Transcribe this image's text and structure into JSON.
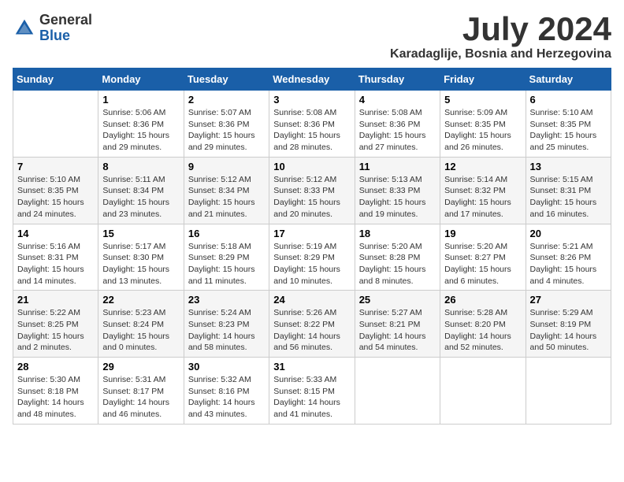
{
  "logo": {
    "general": "General",
    "blue": "Blue"
  },
  "title": "July 2024",
  "location": "Karadaglije, Bosnia and Herzegovina",
  "weekdays": [
    "Sunday",
    "Monday",
    "Tuesday",
    "Wednesday",
    "Thursday",
    "Friday",
    "Saturday"
  ],
  "weeks": [
    [
      {
        "day": "",
        "sunrise": "",
        "sunset": "",
        "daylight": ""
      },
      {
        "day": "1",
        "sunrise": "Sunrise: 5:06 AM",
        "sunset": "Sunset: 8:36 PM",
        "daylight": "Daylight: 15 hours and 29 minutes."
      },
      {
        "day": "2",
        "sunrise": "Sunrise: 5:07 AM",
        "sunset": "Sunset: 8:36 PM",
        "daylight": "Daylight: 15 hours and 29 minutes."
      },
      {
        "day": "3",
        "sunrise": "Sunrise: 5:08 AM",
        "sunset": "Sunset: 8:36 PM",
        "daylight": "Daylight: 15 hours and 28 minutes."
      },
      {
        "day": "4",
        "sunrise": "Sunrise: 5:08 AM",
        "sunset": "Sunset: 8:36 PM",
        "daylight": "Daylight: 15 hours and 27 minutes."
      },
      {
        "day": "5",
        "sunrise": "Sunrise: 5:09 AM",
        "sunset": "Sunset: 8:35 PM",
        "daylight": "Daylight: 15 hours and 26 minutes."
      },
      {
        "day": "6",
        "sunrise": "Sunrise: 5:10 AM",
        "sunset": "Sunset: 8:35 PM",
        "daylight": "Daylight: 15 hours and 25 minutes."
      }
    ],
    [
      {
        "day": "7",
        "sunrise": "Sunrise: 5:10 AM",
        "sunset": "Sunset: 8:35 PM",
        "daylight": "Daylight: 15 hours and 24 minutes."
      },
      {
        "day": "8",
        "sunrise": "Sunrise: 5:11 AM",
        "sunset": "Sunset: 8:34 PM",
        "daylight": "Daylight: 15 hours and 23 minutes."
      },
      {
        "day": "9",
        "sunrise": "Sunrise: 5:12 AM",
        "sunset": "Sunset: 8:34 PM",
        "daylight": "Daylight: 15 hours and 21 minutes."
      },
      {
        "day": "10",
        "sunrise": "Sunrise: 5:12 AM",
        "sunset": "Sunset: 8:33 PM",
        "daylight": "Daylight: 15 hours and 20 minutes."
      },
      {
        "day": "11",
        "sunrise": "Sunrise: 5:13 AM",
        "sunset": "Sunset: 8:33 PM",
        "daylight": "Daylight: 15 hours and 19 minutes."
      },
      {
        "day": "12",
        "sunrise": "Sunrise: 5:14 AM",
        "sunset": "Sunset: 8:32 PM",
        "daylight": "Daylight: 15 hours and 17 minutes."
      },
      {
        "day": "13",
        "sunrise": "Sunrise: 5:15 AM",
        "sunset": "Sunset: 8:31 PM",
        "daylight": "Daylight: 15 hours and 16 minutes."
      }
    ],
    [
      {
        "day": "14",
        "sunrise": "Sunrise: 5:16 AM",
        "sunset": "Sunset: 8:31 PM",
        "daylight": "Daylight: 15 hours and 14 minutes."
      },
      {
        "day": "15",
        "sunrise": "Sunrise: 5:17 AM",
        "sunset": "Sunset: 8:30 PM",
        "daylight": "Daylight: 15 hours and 13 minutes."
      },
      {
        "day": "16",
        "sunrise": "Sunrise: 5:18 AM",
        "sunset": "Sunset: 8:29 PM",
        "daylight": "Daylight: 15 hours and 11 minutes."
      },
      {
        "day": "17",
        "sunrise": "Sunrise: 5:19 AM",
        "sunset": "Sunset: 8:29 PM",
        "daylight": "Daylight: 15 hours and 10 minutes."
      },
      {
        "day": "18",
        "sunrise": "Sunrise: 5:20 AM",
        "sunset": "Sunset: 8:28 PM",
        "daylight": "Daylight: 15 hours and 8 minutes."
      },
      {
        "day": "19",
        "sunrise": "Sunrise: 5:20 AM",
        "sunset": "Sunset: 8:27 PM",
        "daylight": "Daylight: 15 hours and 6 minutes."
      },
      {
        "day": "20",
        "sunrise": "Sunrise: 5:21 AM",
        "sunset": "Sunset: 8:26 PM",
        "daylight": "Daylight: 15 hours and 4 minutes."
      }
    ],
    [
      {
        "day": "21",
        "sunrise": "Sunrise: 5:22 AM",
        "sunset": "Sunset: 8:25 PM",
        "daylight": "Daylight: 15 hours and 2 minutes."
      },
      {
        "day": "22",
        "sunrise": "Sunrise: 5:23 AM",
        "sunset": "Sunset: 8:24 PM",
        "daylight": "Daylight: 15 hours and 0 minutes."
      },
      {
        "day": "23",
        "sunrise": "Sunrise: 5:24 AM",
        "sunset": "Sunset: 8:23 PM",
        "daylight": "Daylight: 14 hours and 58 minutes."
      },
      {
        "day": "24",
        "sunrise": "Sunrise: 5:26 AM",
        "sunset": "Sunset: 8:22 PM",
        "daylight": "Daylight: 14 hours and 56 minutes."
      },
      {
        "day": "25",
        "sunrise": "Sunrise: 5:27 AM",
        "sunset": "Sunset: 8:21 PM",
        "daylight": "Daylight: 14 hours and 54 minutes."
      },
      {
        "day": "26",
        "sunrise": "Sunrise: 5:28 AM",
        "sunset": "Sunset: 8:20 PM",
        "daylight": "Daylight: 14 hours and 52 minutes."
      },
      {
        "day": "27",
        "sunrise": "Sunrise: 5:29 AM",
        "sunset": "Sunset: 8:19 PM",
        "daylight": "Daylight: 14 hours and 50 minutes."
      }
    ],
    [
      {
        "day": "28",
        "sunrise": "Sunrise: 5:30 AM",
        "sunset": "Sunset: 8:18 PM",
        "daylight": "Daylight: 14 hours and 48 minutes."
      },
      {
        "day": "29",
        "sunrise": "Sunrise: 5:31 AM",
        "sunset": "Sunset: 8:17 PM",
        "daylight": "Daylight: 14 hours and 46 minutes."
      },
      {
        "day": "30",
        "sunrise": "Sunrise: 5:32 AM",
        "sunset": "Sunset: 8:16 PM",
        "daylight": "Daylight: 14 hours and 43 minutes."
      },
      {
        "day": "31",
        "sunrise": "Sunrise: 5:33 AM",
        "sunset": "Sunset: 8:15 PM",
        "daylight": "Daylight: 14 hours and 41 minutes."
      },
      {
        "day": "",
        "sunrise": "",
        "sunset": "",
        "daylight": ""
      },
      {
        "day": "",
        "sunrise": "",
        "sunset": "",
        "daylight": ""
      },
      {
        "day": "",
        "sunrise": "",
        "sunset": "",
        "daylight": ""
      }
    ]
  ]
}
